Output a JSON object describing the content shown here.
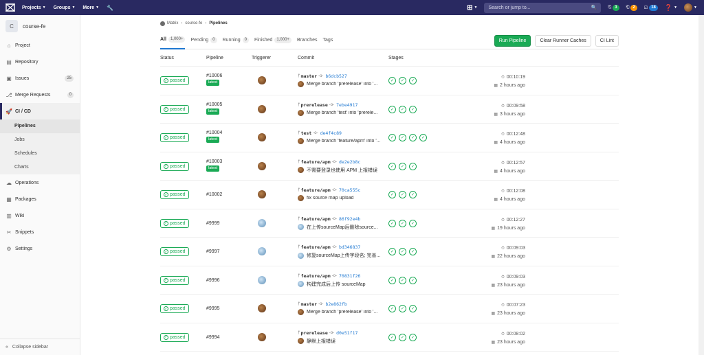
{
  "topbar": {
    "nav": [
      "Projects",
      "Groups",
      "More"
    ],
    "search_placeholder": "Search or jump to...",
    "badges": [
      {
        "icon": "merge-icon",
        "count": "3",
        "color": "#1aaa55"
      },
      {
        "icon": "issues-icon",
        "count": "2",
        "color": "#fc9403"
      },
      {
        "icon": "todo-icon",
        "count": "18",
        "color": "#1f78d1"
      }
    ]
  },
  "sidebar": {
    "project_initial": "C",
    "project_name": "course-fe",
    "items": [
      {
        "label": "Project",
        "icon": "home-icon"
      },
      {
        "label": "Repository",
        "icon": "book-icon"
      },
      {
        "label": "Issues",
        "icon": "issues-icon",
        "count": "25"
      },
      {
        "label": "Merge Requests",
        "icon": "merge-icon",
        "count": "0"
      },
      {
        "label": "CI / CD",
        "icon": "rocket-icon"
      }
    ],
    "sub_items": [
      "Pipelines",
      "Jobs",
      "Schedules",
      "Charts"
    ],
    "items_after": [
      {
        "label": "Operations",
        "icon": "cloud-icon"
      },
      {
        "label": "Packages",
        "icon": "package-icon"
      },
      {
        "label": "Wiki",
        "icon": "book-icon"
      },
      {
        "label": "Snippets",
        "icon": "scissors-icon"
      },
      {
        "label": "Settings",
        "icon": "gear-icon"
      }
    ],
    "collapse_label": "Collapse sidebar"
  },
  "breadcrumb": {
    "group": "Matrix",
    "project": "course-fe",
    "current": "Pipelines"
  },
  "tabs": [
    {
      "label": "All",
      "count": "1,000+"
    },
    {
      "label": "Pending",
      "count": "0"
    },
    {
      "label": "Running",
      "count": "0"
    },
    {
      "label": "Finished",
      "count": "1,000+"
    },
    {
      "label": "Branches",
      "count": ""
    },
    {
      "label": "Tags",
      "count": ""
    }
  ],
  "buttons": {
    "run": "Run Pipeline",
    "clear": "Clear Runner Caches",
    "lint": "CI Lint"
  },
  "columns": {
    "status": "Status",
    "pipeline": "Pipeline",
    "triggerer": "Triggerer",
    "commit": "Commit",
    "stages": "Stages"
  },
  "rows": [
    {
      "status": "passed",
      "id": "#10006",
      "latest": "latest",
      "avatar": "brown",
      "branch": "master",
      "hash": "b6dcb527",
      "msg": "Merge branch 'prerelease' into '...",
      "stages": 3,
      "duration": "00:10:19",
      "ago": "2 hours ago"
    },
    {
      "status": "passed",
      "id": "#10005",
      "latest": "latest",
      "avatar": "brown",
      "branch": "prerelease",
      "hash": "7ebe4917",
      "msg": "Merge branch 'test' into 'prerele...",
      "stages": 3,
      "duration": "00:09:58",
      "ago": "3 hours ago"
    },
    {
      "status": "passed",
      "id": "#10004",
      "latest": "latest",
      "avatar": "brown",
      "branch": "test",
      "hash": "de4f4c89",
      "msg": "Merge branch 'feature/apm' into '...",
      "stages": 4,
      "duration": "00:12:48",
      "ago": "4 hours ago"
    },
    {
      "status": "passed",
      "id": "#10003",
      "latest": "latest",
      "avatar": "brown",
      "branch": "feature/apm",
      "hash": "de2e2b8c",
      "msg": "不需要登录也使用 APM 上报错误",
      "stages": 3,
      "duration": "00:12:57",
      "ago": "4 hours ago"
    },
    {
      "status": "passed",
      "id": "#10002",
      "latest": "",
      "avatar": "brown",
      "branch": "feature/apm",
      "hash": "70ca555c",
      "msg": "fix source map upload",
      "stages": 3,
      "duration": "00:12:08",
      "ago": "4 hours ago"
    },
    {
      "status": "passed",
      "id": "#9999",
      "latest": "",
      "avatar": "blue",
      "branch": "feature/apm",
      "hash": "86f92e4b",
      "msg": "在上传sourceMap后删除source...",
      "stages": 3,
      "duration": "00:12:27",
      "ago": "19 hours ago"
    },
    {
      "status": "passed",
      "id": "#9997",
      "latest": "",
      "avatar": "blue",
      "branch": "feature/apm",
      "hash": "bd346837",
      "msg": "修复sourceMap上传字段名; 完善...",
      "stages": 3,
      "duration": "00:09:03",
      "ago": "22 hours ago"
    },
    {
      "status": "passed",
      "id": "#9996",
      "latest": "",
      "avatar": "blue",
      "branch": "feature/apm",
      "hash": "70831f26",
      "msg": "构建完成后上传 sourceMap",
      "stages": 3,
      "duration": "00:09:03",
      "ago": "23 hours ago"
    },
    {
      "status": "passed",
      "id": "#9995",
      "latest": "",
      "avatar": "brown",
      "branch": "master",
      "hash": "b2e862fb",
      "msg": "Merge branch 'prerelease' into '...",
      "stages": 3,
      "duration": "00:07:23",
      "ago": "23 hours ago"
    },
    {
      "status": "passed",
      "id": "#9994",
      "latest": "",
      "avatar": "brown",
      "branch": "prerelease",
      "hash": "d0e51f17",
      "msg": "静默上报错误",
      "stages": 3,
      "duration": "00:08:02",
      "ago": "23 hours ago"
    }
  ]
}
